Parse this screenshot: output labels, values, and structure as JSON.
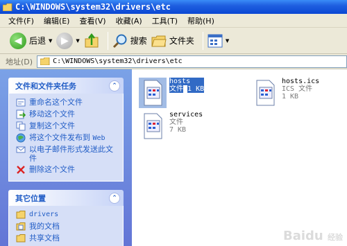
{
  "window": {
    "title": "C:\\WINDOWS\\system32\\drivers\\etc"
  },
  "menu": [
    "文件(F)",
    "编辑(E)",
    "查看(V)",
    "收藏(A)",
    "工具(T)",
    "帮助(H)"
  ],
  "toolbar": {
    "back_label": "后退",
    "search_label": "搜索",
    "folders_label": "文件夹"
  },
  "address": {
    "label": "地址(D)",
    "path": "C:\\WINDOWS\\system32\\drivers\\etc"
  },
  "tasks_panel": {
    "title": "文件和文件夹任务",
    "items": [
      {
        "label": "重命名这个文件",
        "icon": "rename-icon"
      },
      {
        "label": "移动这个文件",
        "icon": "move-icon"
      },
      {
        "label": "复制这个文件",
        "icon": "copy-icon"
      },
      {
        "label": "将这个文件发布到",
        "suffix": "Web",
        "icon": "publish-web-icon"
      },
      {
        "label": "以电子邮件形式发送此文件",
        "icon": "email-icon"
      },
      {
        "label": "删除这个文件",
        "icon": "delete-icon"
      }
    ]
  },
  "other_places_panel": {
    "title": "其它位置",
    "items": [
      {
        "label": "drivers",
        "icon": "folder-icon"
      },
      {
        "label": "我的文档",
        "icon": "my-documents-icon"
      },
      {
        "label": "共享文档",
        "icon": "shared-documents-icon"
      }
    ]
  },
  "files": [
    {
      "name": "hosts",
      "type": "文件",
      "size": "1 KB",
      "selected": true
    },
    {
      "name": "hosts.ics",
      "type": "ICS 文件",
      "size": "1 KB",
      "selected": false
    },
    {
      "name": "services",
      "type": "文件",
      "size": "7 KB",
      "selected": false
    }
  ],
  "watermark": {
    "brand": "Baidu",
    "sub": "经验"
  },
  "colors": {
    "title_bar": "#0a47d4",
    "task_pane": "#6375d6",
    "link": "#215dc6",
    "selection": "#316ac5"
  }
}
